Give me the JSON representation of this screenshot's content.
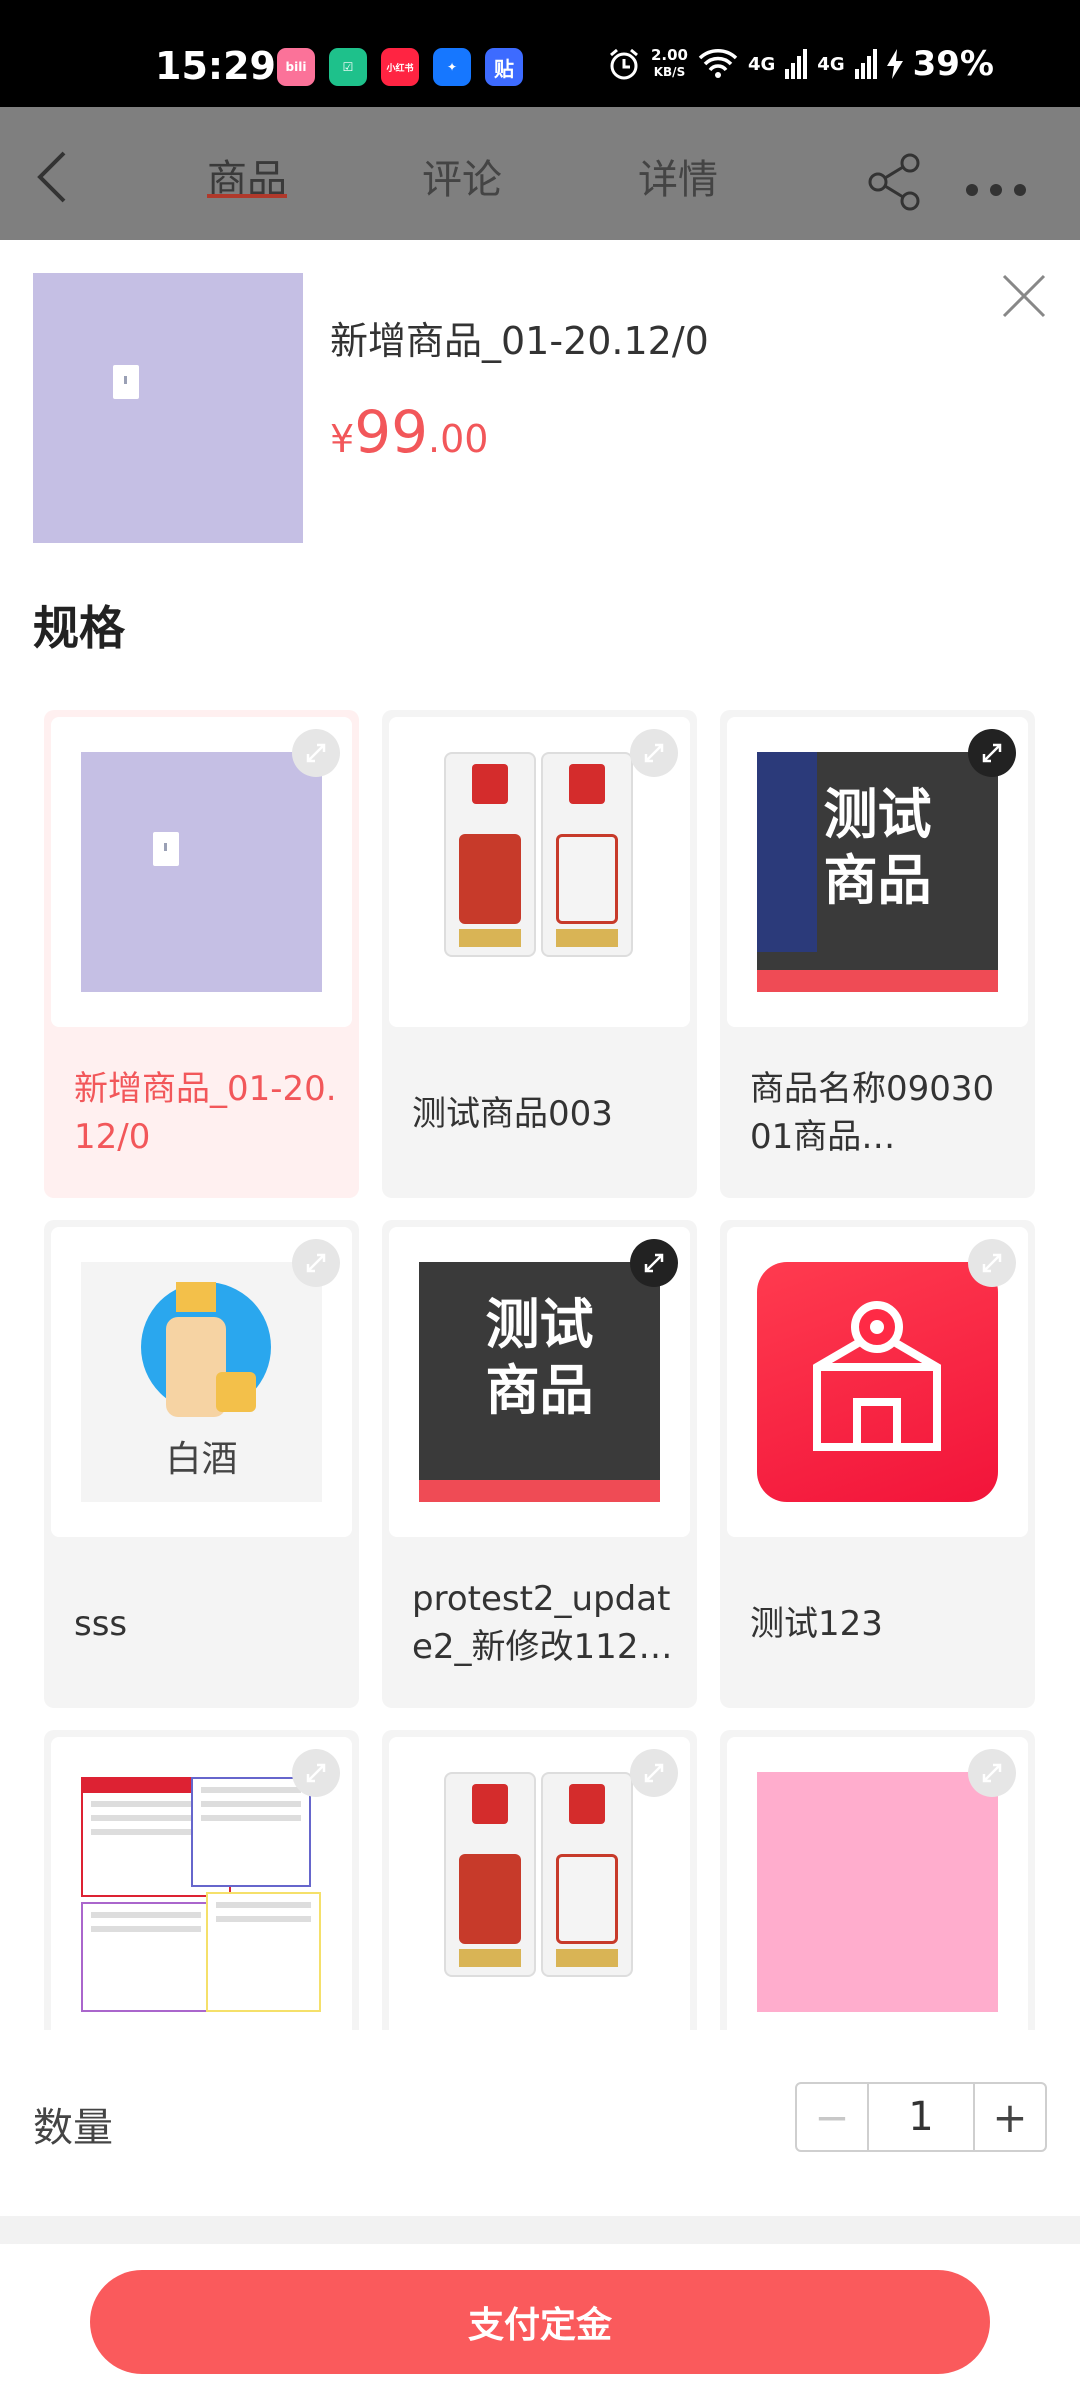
{
  "status_bar": {
    "time": "15:29",
    "apps": [
      {
        "name": "bilibili",
        "text": "bili",
        "color": "#fb7299"
      },
      {
        "name": "app-green",
        "text": "☑",
        "color": "#1ec18b"
      },
      {
        "name": "xiaohongshu",
        "text": "小红书",
        "color": "#ff2442"
      },
      {
        "name": "app-blue",
        "text": "✦",
        "color": "#1677ff"
      },
      {
        "name": "tieba",
        "text": "贴",
        "color": "#3d6bff"
      }
    ],
    "net_speed": "2.00",
    "net_unit": "KB/S",
    "signal1": "4G",
    "signal2": "4G",
    "battery": "39%"
  },
  "header": {
    "tabs": [
      "商品",
      "评论",
      "详情"
    ],
    "active_tab": "商品"
  },
  "product": {
    "title": "新增商品_01-20.12/0",
    "price_symbol": "¥",
    "price_integer": "99",
    "price_decimal": ".00"
  },
  "spec": {
    "title": "规格",
    "items": [
      {
        "label": "新增商品_01-20.12/0",
        "selected": true,
        "picture": "lavender-placeholder"
      },
      {
        "label": "测试商品003",
        "selected": false,
        "picture": "baijiu-bottles"
      },
      {
        "label": "商品名称0903001商品…",
        "selected": false,
        "picture": "dark-test-product",
        "picture_text": "测试商品"
      },
      {
        "label": "sss",
        "selected": false,
        "picture": "baijiu-icon",
        "picture_text": "白酒"
      },
      {
        "label": "protest2_update2_新修改112…",
        "selected": false,
        "picture": "dark-test-product",
        "picture_text": "测试商品"
      },
      {
        "label": "测试123",
        "selected": false,
        "picture": "red-store-icon"
      },
      {
        "label": "",
        "selected": false,
        "picture": "form-screenshot"
      },
      {
        "label": "",
        "selected": false,
        "picture": "baijiu-bottles"
      },
      {
        "label": "",
        "selected": false,
        "picture": "pink-placeholder"
      }
    ]
  },
  "quantity": {
    "label": "数量",
    "value": "1",
    "minus": "−",
    "plus": "+"
  },
  "action": {
    "pay_label": "支付定金"
  },
  "colors": {
    "accent": "#fa5a5c",
    "price": "#f2575a",
    "selected_bg": "#fff0f0"
  }
}
